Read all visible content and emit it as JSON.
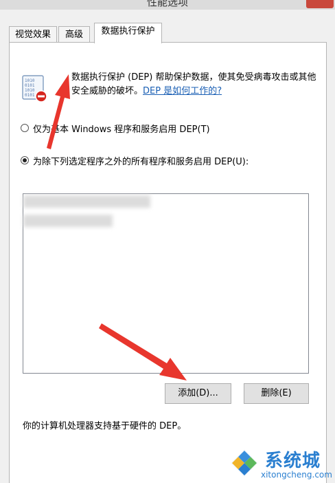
{
  "window": {
    "title": "性能选项"
  },
  "tabs": [
    {
      "label": "视觉效果",
      "active": false
    },
    {
      "label": "高级",
      "active": false
    },
    {
      "label": "数据执行保护",
      "active": true
    }
  ],
  "dep": {
    "description": "数据执行保护 (DEP) 帮助保护数据，使其免受病毒攻击或其他安全威胁的破坏。",
    "help_link": "DEP 是如何工作的?",
    "icon": "dep-shield-icon"
  },
  "options": [
    {
      "label": "仅为基本 Windows 程序和服务启用 DEP(T)",
      "checked": false
    },
    {
      "label": "为除下列选定程序之外的所有程序和服务启用 DEP(U):",
      "checked": true
    }
  ],
  "buttons": {
    "add": "添加(D)...",
    "remove": "删除(E)"
  },
  "footer": {
    "text": "你的计算机处理器支持基于硬件的 DEP。"
  },
  "watermark": {
    "cn": "系统城",
    "en": "xitongcheng.com"
  },
  "colors": {
    "link": "#1a5fb4",
    "arrow": "#e8362d",
    "watermark": "#2a7fd0"
  }
}
